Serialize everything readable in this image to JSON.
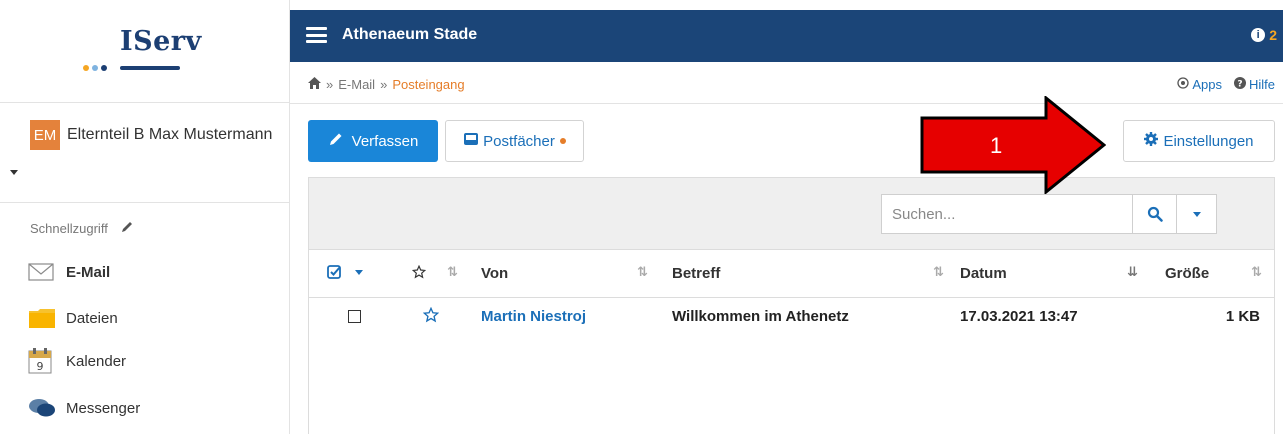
{
  "sidebar": {
    "logo_text": "IServ",
    "avatar_initials": "EM",
    "user_name": "Elternteil B Max Mustermann",
    "quick_access_label": "Schnellzugriff",
    "items": [
      {
        "label": "E-Mail",
        "icon": "envelope-icon",
        "active": true
      },
      {
        "label": "Dateien",
        "icon": "folder-icon"
      },
      {
        "label": "Kalender",
        "icon": "calendar-icon",
        "day": "9"
      },
      {
        "label": "Messenger",
        "icon": "chat-bubbles-icon"
      }
    ]
  },
  "topbar": {
    "school": "Athenaeum Stade",
    "notification_count": "2"
  },
  "breadcrumb": {
    "sep": "»",
    "items": [
      "E-Mail",
      "Posteingang"
    ]
  },
  "top_links": {
    "apps": "Apps",
    "help": "Hilfe"
  },
  "toolbar": {
    "compose_label": "Verfassen",
    "mailboxes_label": "Postfächer",
    "settings_label": "Einstellungen"
  },
  "search": {
    "placeholder": "Suchen..."
  },
  "table": {
    "columns": {
      "from": "Von",
      "subject": "Betreff",
      "date": "Datum",
      "size": "Größe"
    },
    "rows": [
      {
        "from": "Martin Niestroj",
        "subject": "Willkommen im Athenetz",
        "date": "17.03.2021 13:47",
        "size": "1 KB"
      }
    ]
  },
  "annotation": {
    "arrow_number": "1",
    "arrow_color": "#e60000"
  },
  "colors": {
    "topbar": "#1b4578",
    "primary": "#1a86d8",
    "link": "#1b6fb8",
    "accent_orange": "#e57d29",
    "avatar": "#e4823b"
  }
}
